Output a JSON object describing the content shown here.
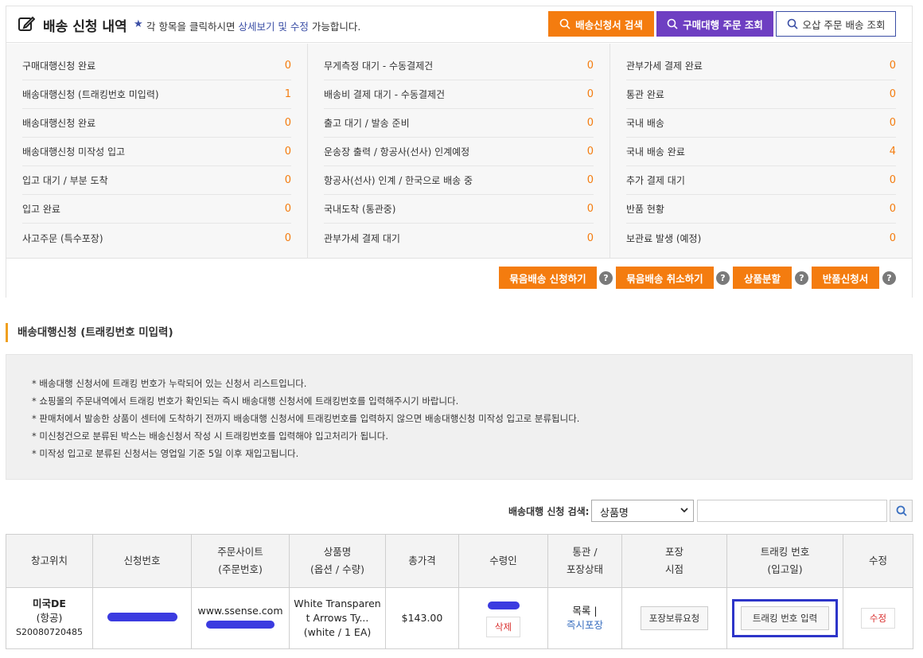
{
  "header": {
    "title": "배송 신청 내역",
    "hint_prefix": "각 항목을 클릭하시면",
    "hint_link": "상세보기 및 수정",
    "hint_suffix": "가능합니다.",
    "btn_search_order": "배송신청서 검색",
    "btn_purchase_lookup": "구매대행 주문 조회",
    "btn_misdelivery_lookup": "오삽 주문 배송 조회"
  },
  "status": {
    "col1": [
      {
        "label": "구매대행신청 완료",
        "count": "0"
      },
      {
        "label": "배송대행신청 (트래킹번호 미입력)",
        "count": "1"
      },
      {
        "label": "배송대행신청 완료",
        "count": "0"
      },
      {
        "label": "배송대행신청 미작성 입고",
        "count": "0"
      },
      {
        "label": "입고 대기 / 부분 도착",
        "count": "0"
      },
      {
        "label": "입고 완료",
        "count": "0"
      },
      {
        "label": "사고주문 (특수포장)",
        "count": "0"
      }
    ],
    "col2": [
      {
        "label": "무게측정 대기 - 수동결제건",
        "count": "0"
      },
      {
        "label": "배송비 결제 대기 - 수동결제건",
        "count": "0"
      },
      {
        "label": "출고 대기 / 발송 준비",
        "count": "0"
      },
      {
        "label": "운송장 출력 / 항공사(선사) 인계예정",
        "count": "0"
      },
      {
        "label": "항공사(선사) 인계 / 한국으로 배송 중",
        "count": "0"
      },
      {
        "label": "국내도착 (통관중)",
        "count": "0"
      },
      {
        "label": "관부가세 결제 대기",
        "count": "0"
      }
    ],
    "col3": [
      {
        "label": "관부가세 결제 완료",
        "count": "0"
      },
      {
        "label": "통관 완료",
        "count": "0"
      },
      {
        "label": "국내 배송",
        "count": "0"
      },
      {
        "label": "국내 배송 완료",
        "count": "4"
      },
      {
        "label": "추가 결제 대기",
        "count": "0"
      },
      {
        "label": "반품 현황",
        "count": "0"
      },
      {
        "label": "보관료 발생 (예정)",
        "count": "0"
      }
    ]
  },
  "actions": {
    "bundle_apply": "묶음배송 신청하기",
    "bundle_cancel": "묶음배송 취소하기",
    "split": "상품분할",
    "return": "반품신청서",
    "help": "?"
  },
  "section": {
    "title": "배송대행신청 (트래킹번호 미입력)",
    "notices": [
      "* 배송대행 신청서에 트래킹 번호가 누락되어 있는 신청서 리스트입니다.",
      "* 쇼핑몰의 주문내역에서 트래킹 번호가 확인되는 즉시 배송대행 신청서에 트래킹번호를 입력해주시기 바랍니다.",
      "* 판매처에서 발송한 상품이 센터에 도착하기 전까지 배송대행 신청서에 트래킹번호를 입력하지 않으면 배송대행신청 미작성 입고로 분류됩니다.",
      "* 미신청건으로 분류된 박스는 배송신청서 작성 시 트래킹번호를 입력해야 입고처리가 됩니다.",
      "* 미작성 입고로 분류된 신청서는 영업일 기준 5일 이후 재입고됩니다."
    ]
  },
  "search": {
    "label": "배송대행 신청 검색:",
    "selected": "상품명"
  },
  "table": {
    "headers": [
      [
        "창고위치"
      ],
      [
        "신청번호"
      ],
      [
        "주문사이트",
        "(주문번호)"
      ],
      [
        "상품명",
        "(옵션 / 수량)"
      ],
      [
        "총가격"
      ],
      [
        "수령인"
      ],
      [
        "통관 /",
        "포장상태"
      ],
      [
        "포장",
        "시점"
      ],
      [
        "트래킹 번호",
        "(입고일)"
      ],
      [
        "수정"
      ]
    ],
    "row": {
      "warehouse": "미국DE",
      "warehouse_sub": "(항공)",
      "warehouse_code": "S20080720485",
      "site": "www.ssense.com",
      "product_line1": "White Transparen",
      "product_line2": "t Arrows Ty...",
      "product_line3": "(white / 1 EA)",
      "price": "$143.00",
      "delete": "삭제",
      "customs": "목록 |",
      "packing": "즉시포장",
      "hold_btn": "포장보류요청",
      "tracking_btn": "트래킹 번호 입력",
      "edit": "수정"
    }
  },
  "colors": {
    "orange": "#f47c0f",
    "purple": "#6e3fc2",
    "navy": "#3a4ea5",
    "highlight": "#2d35c9",
    "redaction": "#3b3be0"
  }
}
